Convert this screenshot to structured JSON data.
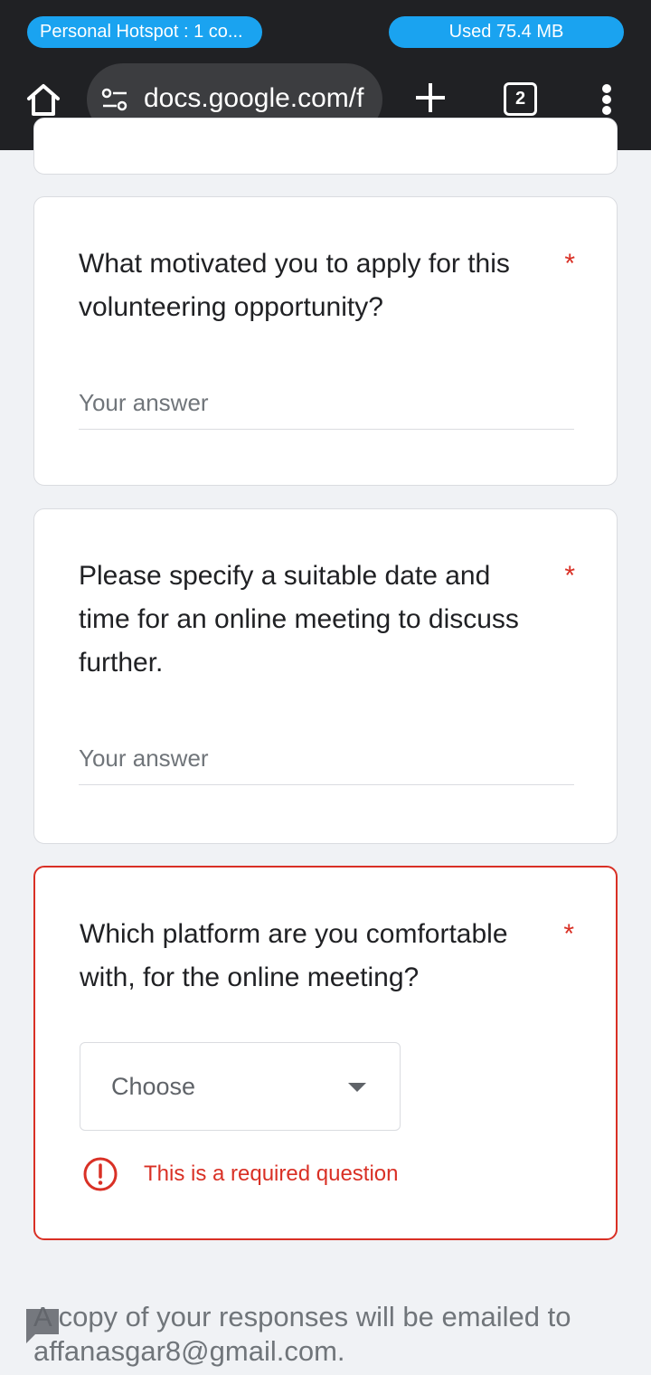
{
  "status_bar": {
    "hotspot_label": "Personal Hotspot : 1 co...",
    "data_used_label": "Used  75.4 MB"
  },
  "browser": {
    "url": "docs.google.com/f",
    "tab_count": "2",
    "icons": [
      "home-icon",
      "site-settings-icon",
      "new-tab-icon",
      "tab-switcher-icon",
      "more-menu-icon"
    ]
  },
  "form": {
    "questions": [
      {
        "text": "What motivated you to apply for this volunteering opportunity?",
        "required_mark": "*",
        "placeholder": "Your answer"
      },
      {
        "text": "Please specify a suitable date and time for an online meeting to discuss further.",
        "required_mark": "*",
        "placeholder": "Your answer"
      },
      {
        "text": "Which platform are you comfortable with, for the online meeting?",
        "required_mark": "*",
        "dropdown_value": "Choose",
        "error_message": "This is a required question"
      }
    ],
    "footer_note": "A copy of your responses will be emailed to affanasgar8@gmail.com."
  },
  "colors": {
    "accent_blue": "#1aa3f0",
    "error_red": "#d93025",
    "chrome_bg": "#202124",
    "page_bg": "#f0f2f5"
  }
}
